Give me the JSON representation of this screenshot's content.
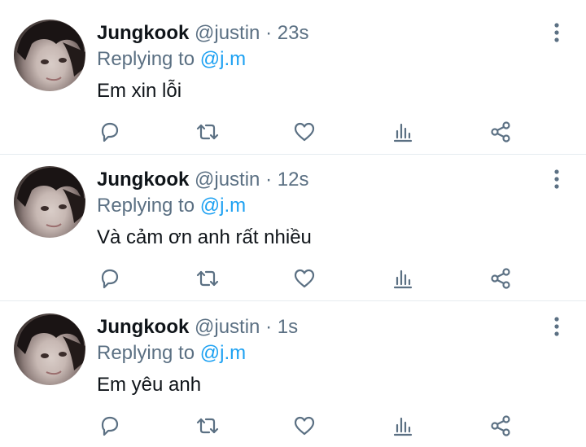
{
  "tweets": [
    {
      "name": "Jungkook",
      "handle": "@justin",
      "separator": "·",
      "time": "23s",
      "reply_prefix": "Replying to",
      "reply_to": "@j.m",
      "text": "Em xin lỗi"
    },
    {
      "name": "Jungkook",
      "handle": "@justin",
      "separator": "·",
      "time": "12s",
      "reply_prefix": "Replying to",
      "reply_to": "@j.m",
      "text": "Và cảm ơn anh rất nhiều"
    },
    {
      "name": "Jungkook",
      "handle": "@justin",
      "separator": "·",
      "time": "1s",
      "reply_prefix": "Replying to",
      "reply_to": "@j.m",
      "text": "Em yêu anh"
    }
  ],
  "icons": {
    "more": "more-vertical-icon",
    "reply": "reply-icon",
    "retweet": "retweet-icon",
    "like": "heart-icon",
    "stats": "analytics-icon",
    "share": "share-icon"
  },
  "colors": {
    "text": "#0f1419",
    "secondary": "#5b7083",
    "mention": "#1da1f2",
    "divider": "#e6ecf0"
  }
}
